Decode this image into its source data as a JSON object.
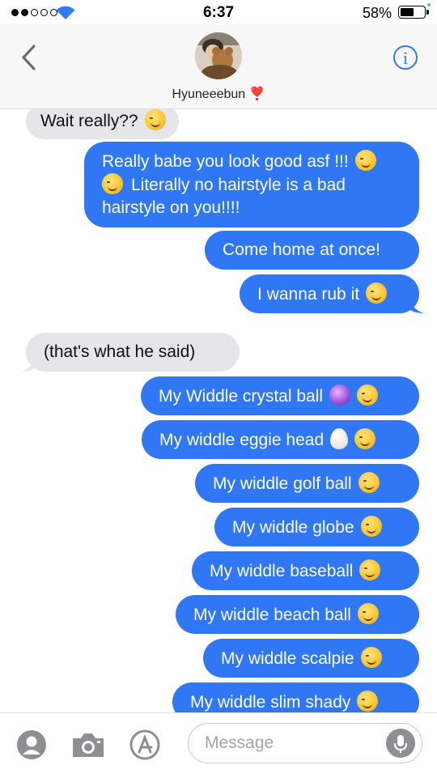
{
  "status_bar": {
    "time": "6:37",
    "battery_percent": "58%",
    "battery_level": 0.58,
    "signal_dots_filled": 2,
    "signal_dots_total": 5
  },
  "header": {
    "back_icon": "chevron-left-icon",
    "contact_name": "Hyuneeebun ❣️",
    "info_icon": "info-icon",
    "info_glyph": "i"
  },
  "messages": [
    {
      "side": "received",
      "text": "Wait really??",
      "emoji": "relieved"
    },
    {
      "side": "sent",
      "lines": [
        "Really babe you look good asf !!!",
        "Literally no hairstyle is a bad",
        "hairstyle on you!!!!"
      ]
    },
    {
      "side": "sent",
      "text": "Come home at once!"
    },
    {
      "side": "sent",
      "text": "I wanna rub it",
      "emoji": "slight-smile"
    },
    {
      "side": "received",
      "text": "(that's what he said)"
    },
    {
      "side": "sent",
      "text": "My Widdle crystal ball",
      "emoji": "crystal-ball, smiling"
    },
    {
      "side": "sent",
      "text": "My widdle eggie head",
      "emoji": "egg, smiling"
    },
    {
      "side": "sent",
      "text": "My widdle golf ball",
      "emoji": "smiling"
    },
    {
      "side": "sent",
      "text": "My widdle globe",
      "emoji": "smiling"
    },
    {
      "side": "sent",
      "text": "My widdle baseball",
      "emoji": "smiling"
    },
    {
      "side": "sent",
      "text": "My widdle beach ball",
      "emoji": "smiling"
    },
    {
      "side": "sent",
      "text": "My widdle scalpie",
      "emoji": "smiling"
    },
    {
      "side": "sent",
      "text": "My widdle slim shady",
      "emoji": "smiling"
    }
  ],
  "input_bar": {
    "placeholder": "Message",
    "icons": [
      "memoji-icon",
      "camera-icon",
      "app-store-icon",
      "microphone-icon"
    ]
  },
  "colors": {
    "sent_bubble": "#2f77f4",
    "received_bubble": "#e5e5ea",
    "accent": "#2f7bf5"
  }
}
